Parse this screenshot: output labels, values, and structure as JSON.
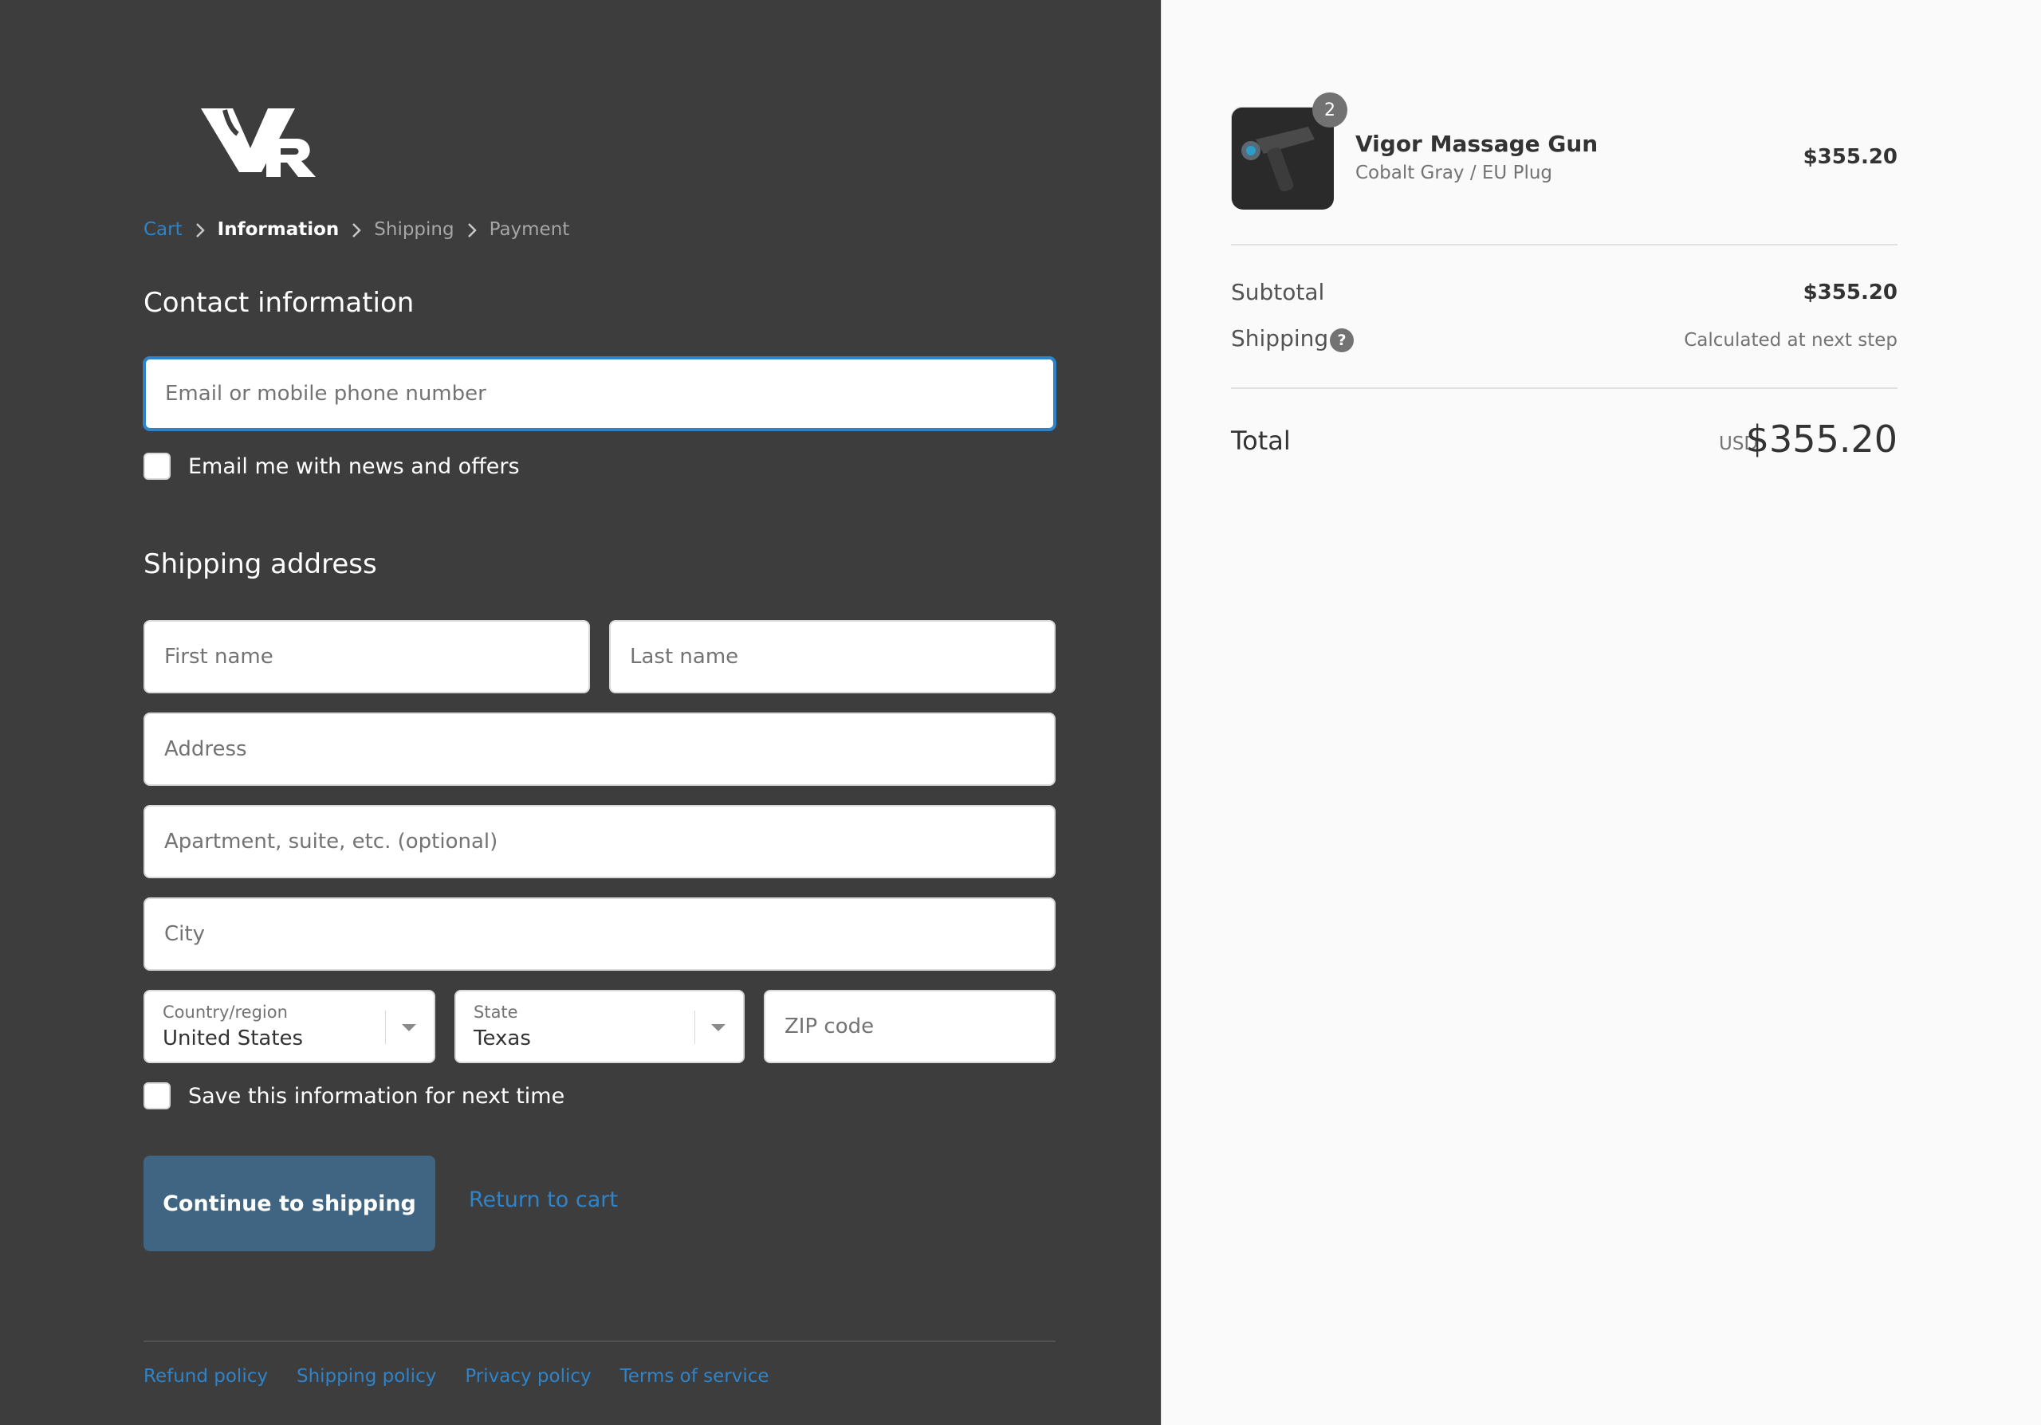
{
  "brand": {
    "logo_text": "VR"
  },
  "breadcrumb": {
    "cart": "Cart",
    "information": "Information",
    "shipping": "Shipping",
    "payment": "Payment"
  },
  "contact": {
    "heading": "Contact information",
    "email_placeholder": "Email or mobile phone number",
    "newsletter_label": "Email me with news and offers"
  },
  "shipping": {
    "heading": "Shipping address",
    "first_name_placeholder": "First name",
    "last_name_placeholder": "Last name",
    "address_placeholder": "Address",
    "apartment_placeholder": "Apartment, suite, etc. (optional)",
    "city_placeholder": "City",
    "country_label": "Country/region",
    "country_value": "United States",
    "state_label": "State",
    "state_value": "Texas",
    "zip_placeholder": "ZIP code",
    "save_label": "Save this information for next time"
  },
  "actions": {
    "continue_label": "Continue to shipping",
    "return_label": "Return to cart"
  },
  "footer": {
    "links": [
      "Refund policy",
      "Shipping policy",
      "Privacy policy",
      "Terms of service"
    ]
  },
  "order": {
    "item": {
      "quantity": "2",
      "name": "Vigor Massage Gun",
      "variant": "Cobalt Gray / EU Plug",
      "price": "$355.20"
    },
    "subtotal_label": "Subtotal",
    "subtotal_value": "$355.20",
    "shipping_label": "Shipping",
    "shipping_value": "Calculated at next step",
    "total_label": "Total",
    "currency": "USD",
    "total_value": "$355.20"
  },
  "colors": {
    "left_bg": "#3d3d3d",
    "right_bg": "#fafafa",
    "accent": "#2f83c9",
    "button": "#3f6582"
  }
}
